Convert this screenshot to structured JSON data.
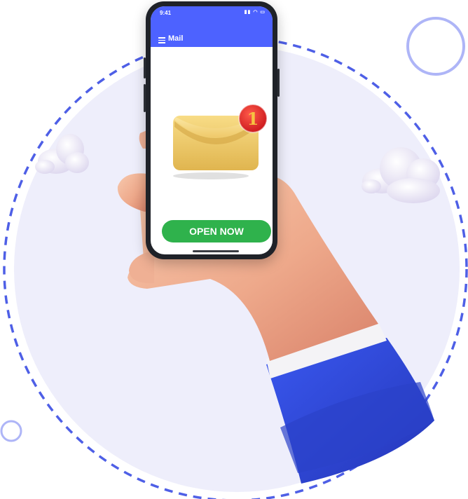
{
  "phone": {
    "status_time": "9:41",
    "status_icons": "▮▮ ◠ ▭"
  },
  "app_bar": {
    "title": "Mail",
    "menu_icon": "hamburger-menu-icon"
  },
  "notification": {
    "badge_count": "1",
    "envelope_icon": "envelope-icon"
  },
  "cta": {
    "label": "OPEN NOW"
  },
  "colors": {
    "app_bar": "#4d62ff",
    "button": "#2fb24c",
    "badge": "#e8262a",
    "background_circle": "#eeeefb",
    "dashed_ring": "#4e5fe6",
    "sleeve": "#2f49d6"
  }
}
